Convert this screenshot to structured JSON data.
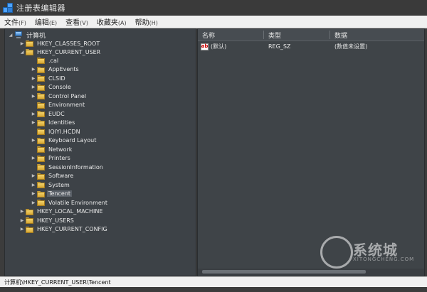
{
  "window": {
    "title": "注册表编辑器"
  },
  "menu": [
    {
      "label": "文件",
      "accel": "(F)"
    },
    {
      "label": "编辑",
      "accel": "(E)"
    },
    {
      "label": "查看",
      "accel": "(V)"
    },
    {
      "label": "收藏夹",
      "accel": "(A)"
    },
    {
      "label": "帮助",
      "accel": "(H)"
    }
  ],
  "tree": {
    "root": "计算机",
    "hkeys": [
      "HKEY_CLASSES_ROOT",
      "HKEY_CURRENT_USER",
      "HKEY_LOCAL_MACHINE",
      "HKEY_USERS",
      "HKEY_CURRENT_CONFIG"
    ],
    "hkcu_children": [
      ".cal",
      "AppEvents",
      "CLSID",
      "Console",
      "Control Panel",
      "Environment",
      "EUDC",
      "Identities",
      "IQIYI.HCDN",
      "Keyboard Layout",
      "Network",
      "Printers",
      "SessionInformation",
      "Software",
      "System",
      "Tencent",
      "Volatile Environment"
    ]
  },
  "list": {
    "headers": {
      "name": "名称",
      "type": "类型",
      "data": "数据"
    },
    "rows": [
      {
        "name": "(默认)",
        "type": "REG_SZ",
        "data": "(数值未设置)"
      }
    ]
  },
  "statusbar": {
    "path": "计算机\\HKEY_CURRENT_USER\\Tencent"
  },
  "watermark": {
    "text": "系统城",
    "sub": "XITONGCHENG.COM"
  },
  "colors": {
    "pane_bg": "#3d4247",
    "folder": "#f3d36a",
    "selection": "#5a6068"
  }
}
